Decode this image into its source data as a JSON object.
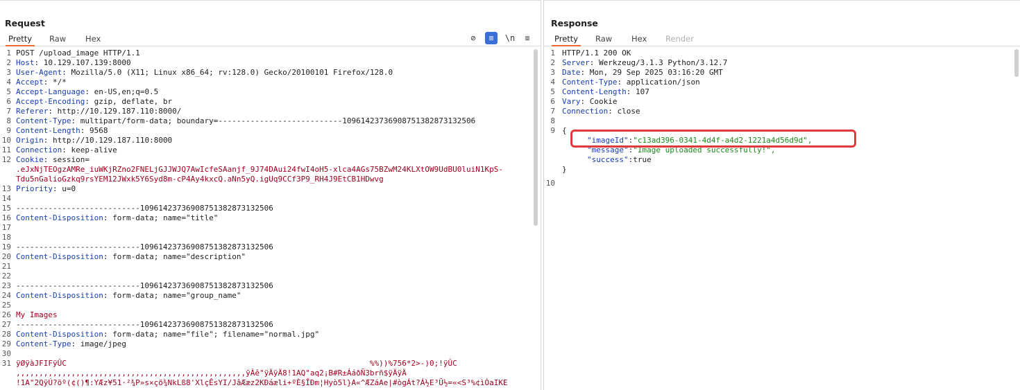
{
  "request": {
    "title": "Request",
    "tabs": [
      "Pretty",
      "Raw",
      "Hex"
    ],
    "active_tab": "Pretty",
    "icons": [
      "eye-slash-icon",
      "wrap-lines-icon",
      "newline-icon",
      "menu-icon"
    ],
    "newline_glyph": "\\n",
    "menu_glyph": "≡",
    "eye_glyph": "⊘",
    "wrap_glyph": "≡",
    "lines": [
      {
        "n": "1",
        "k": "POST /upload_image HTTP/1.1",
        "v": ""
      },
      {
        "n": "2",
        "k": "Host",
        "v": " 10.129.107.139:8000"
      },
      {
        "n": "3",
        "k": "User-Agent",
        "v": " Mozilla/5.0 (X11; Linux x86_64; rv:128.0) Gecko/20100101 Firefox/128.0"
      },
      {
        "n": "4",
        "k": "Accept",
        "v": " */*"
      },
      {
        "n": "5",
        "k": "Accept-Language",
        "v": " en-US,en;q=0.5"
      },
      {
        "n": "6",
        "k": "Accept-Encoding",
        "v": " gzip, deflate, br"
      },
      {
        "n": "7",
        "k": "Referer",
        "v": " http://10.129.187.110:8000/"
      },
      {
        "n": "8",
        "k": "Content-Type",
        "v": " multipart/form-data; boundary=---------------------------10961423736908751382873132506"
      },
      {
        "n": "9",
        "k": "Content-Length",
        "v": " 9568"
      },
      {
        "n": "10",
        "k": "Origin",
        "v": " http://10.129.187.110:8000"
      },
      {
        "n": "11",
        "k": "Connection",
        "v": " keep-alive"
      },
      {
        "n": "12",
        "k": "Cookie",
        "v": " session="
      },
      {
        "n": "",
        "k": "",
        "v": ".eJxNjTEOgzAMRe_iuWKjRZno2FNELjGJJWJQ7AwIcfeSAanjf_9J74DAui24fwI4oH5-xlca4AGs75BZwM24KLXtOW9UdBU0luiN1KpS-"
      },
      {
        "n": "",
        "k": "",
        "v": "Tdu5nGalioGzkq9rsYEM12JWxk5Y6Syd8m-cP4Ay4kxcQ.aNn5yQ.igUq9CCf3P9_RH4J9EtCB1HDwvg"
      },
      {
        "n": "13",
        "k": "Priority",
        "v": " u=0"
      },
      {
        "n": "14",
        "k": "",
        "v": ""
      },
      {
        "n": "15",
        "k": "---------------------------10961423736908751382873132506",
        "v": ""
      },
      {
        "n": "16",
        "k": "Content-Disposition",
        "v": " form-data; name=\"title\""
      },
      {
        "n": "17",
        "k": "",
        "v": ""
      },
      {
        "n": "18",
        "k": "",
        "v": ""
      },
      {
        "n": "19",
        "k": "---------------------------10961423736908751382873132506",
        "v": ""
      },
      {
        "n": "20",
        "k": "Content-Disposition",
        "v": " form-data; name=\"description\""
      },
      {
        "n": "21",
        "k": "",
        "v": ""
      },
      {
        "n": "22",
        "k": "",
        "v": ""
      },
      {
        "n": "23",
        "k": "---------------------------10961423736908751382873132506",
        "v": ""
      },
      {
        "n": "24",
        "k": "Content-Disposition",
        "v": " form-data; name=\"group_name\""
      },
      {
        "n": "25",
        "k": "",
        "v": ""
      },
      {
        "n": "26",
        "k": "",
        "v": "My Images"
      },
      {
        "n": "27",
        "k": "---------------------------10961423736908751382873132506",
        "v": ""
      },
      {
        "n": "28",
        "k": "Content-Disposition",
        "v": " form-data; name=\"file\"; filename=\"normal.jpg\""
      },
      {
        "n": "29",
        "k": "Content-Type",
        "v": " image/jpeg"
      },
      {
        "n": "30",
        "k": "",
        "v": ""
      },
      {
        "n": "31",
        "k": "",
        "v": "ÿØÿàJFIFÿÛC                                                                  %%))%756*2>-)0;!ÿÛC"
      },
      {
        "n": "",
        "k": "",
        "v": ",,,,,,,,,,,,,,,,,,,,,,,,,,,,,,,,,,,,,,,,,,,,,,,,,,ÿÀê\"ÿÄÿÄ8!1AQ\"aq2¡B#R±ÁáðÑ3brñ$ÿÄÿÄ"
      },
      {
        "n": "",
        "k": "",
        "v": "!1A\"2QÿÚ?õº(¢()¶:Y­Æz¥51·²¾P»s×çö¾NkLß8'XlçÊsYI/JâÆæz2KÐáæli+ºÈ§ÎÐm¦Hyò5l}A«^ÆZáAe|#ògÁt?Á½E³Ü½=«<S³%¢ìÒaIKE"
      }
    ]
  },
  "response": {
    "title": "Response",
    "tabs": [
      "Pretty",
      "Raw",
      "Hex",
      "Render"
    ],
    "active_tab": "Pretty",
    "lines": [
      {
        "n": "1",
        "k": "HTTP/1.1 200 OK",
        "v": ""
      },
      {
        "n": "2",
        "k": "Server",
        "v": " Werkzeug/3.1.3 Python/3.12.7"
      },
      {
        "n": "3",
        "k": "Date",
        "v": " Mon, 29 Sep 2025 03:16:20 GMT"
      },
      {
        "n": "4",
        "k": "Content-Type",
        "v": " application/json"
      },
      {
        "n": "5",
        "k": "Content-Length",
        "v": " 107"
      },
      {
        "n": "6",
        "k": "Vary",
        "v": " Cookie"
      },
      {
        "n": "7",
        "k": "Connection",
        "v": " close"
      },
      {
        "n": "8",
        "k": "",
        "v": ""
      },
      {
        "n": "9",
        "k": "",
        "v": "{"
      }
    ],
    "json": [
      {
        "k": "\"imageId\"",
        "v": "\"c13ad396-0341-4d4f-a4d2-1221a4d56d9d\","
      },
      {
        "k": "\"message\"",
        "v": "\"Image uploaded successfully!\","
      },
      {
        "k": "\"success\"",
        "v": "true"
      }
    ],
    "close_brace": "}",
    "last_line_no": "10"
  }
}
